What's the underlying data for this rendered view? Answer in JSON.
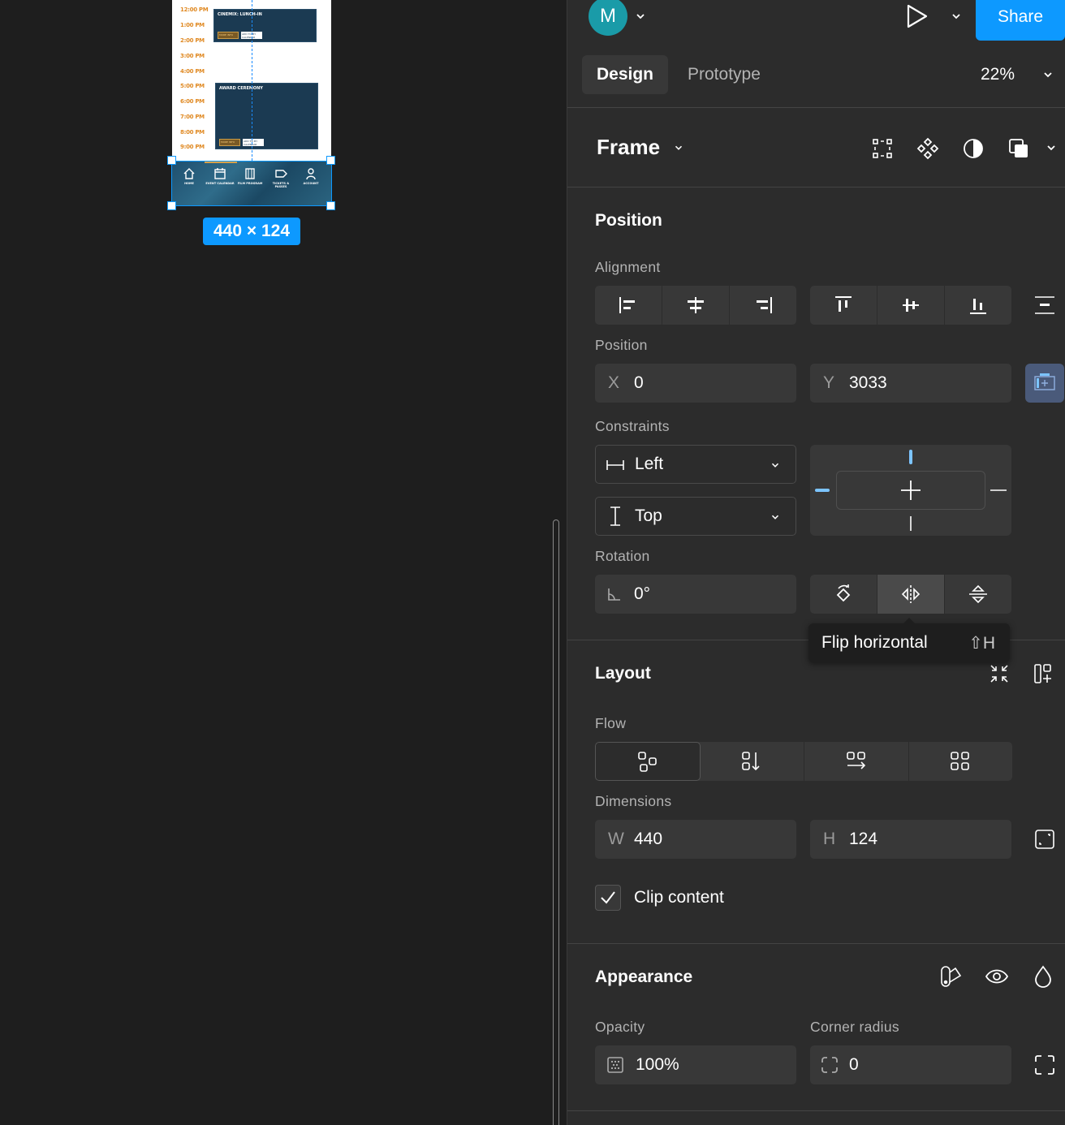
{
  "canvas": {
    "schedule_times": [
      "12:00 PM",
      "1:00 PM",
      "2:00 PM",
      "3:00 PM",
      "4:00 PM",
      "5:00 PM",
      "6:00 PM",
      "7:00 PM",
      "8:00 PM",
      "9:00 PM"
    ],
    "events": [
      {
        "title": "CINEMIX: LUNCH-IN",
        "btn1": "MORE INFO",
        "btn2": "ADD TO MY CALENDAR"
      },
      {
        "title": "AWARD CEREMONY",
        "btn1": "MORE INFO",
        "btn2": "ADD TO MY CALENDAR"
      }
    ],
    "nav_items": [
      "HOME",
      "EVENT CALENDAR",
      "FILM PROGRAM",
      "TICKETS & PASSES",
      "ACCOUNT"
    ],
    "size_badge": "440 × 124"
  },
  "header": {
    "avatar_letter": "M",
    "avatar_color": "#1a9ba8",
    "share_label": "Share",
    "accent_color": "#0d99ff"
  },
  "tabs": {
    "design": "Design",
    "prototype": "Prototype",
    "zoom": "22%"
  },
  "frame": {
    "title": "Frame",
    "icons": [
      "grid-icon",
      "component-icon",
      "mask-icon",
      "boolean-icon"
    ]
  },
  "position": {
    "section_title": "Position",
    "alignment_label": "Alignment",
    "position_label": "Position",
    "x_label": "X",
    "x_value": "0",
    "y_label": "Y",
    "y_value": "3033",
    "constraints_label": "Constraints",
    "h_constraint": "Left",
    "v_constraint": "Top",
    "rotation_label": "Rotation",
    "rotation_value": "0°"
  },
  "tooltip": {
    "text": "Flip horizontal",
    "shortcut": "⇧H"
  },
  "layout": {
    "section_title": "Layout",
    "flow_label": "Flow",
    "dimensions_label": "Dimensions",
    "w_label": "W",
    "w_value": "440",
    "h_label": "H",
    "h_value": "124",
    "clip_content_label": "Clip content",
    "clip_content_checked": true
  },
  "appearance": {
    "section_title": "Appearance",
    "opacity_label": "Opacity",
    "opacity_value": "100%",
    "corner_radius_label": "Corner radius",
    "corner_radius_value": "0"
  }
}
